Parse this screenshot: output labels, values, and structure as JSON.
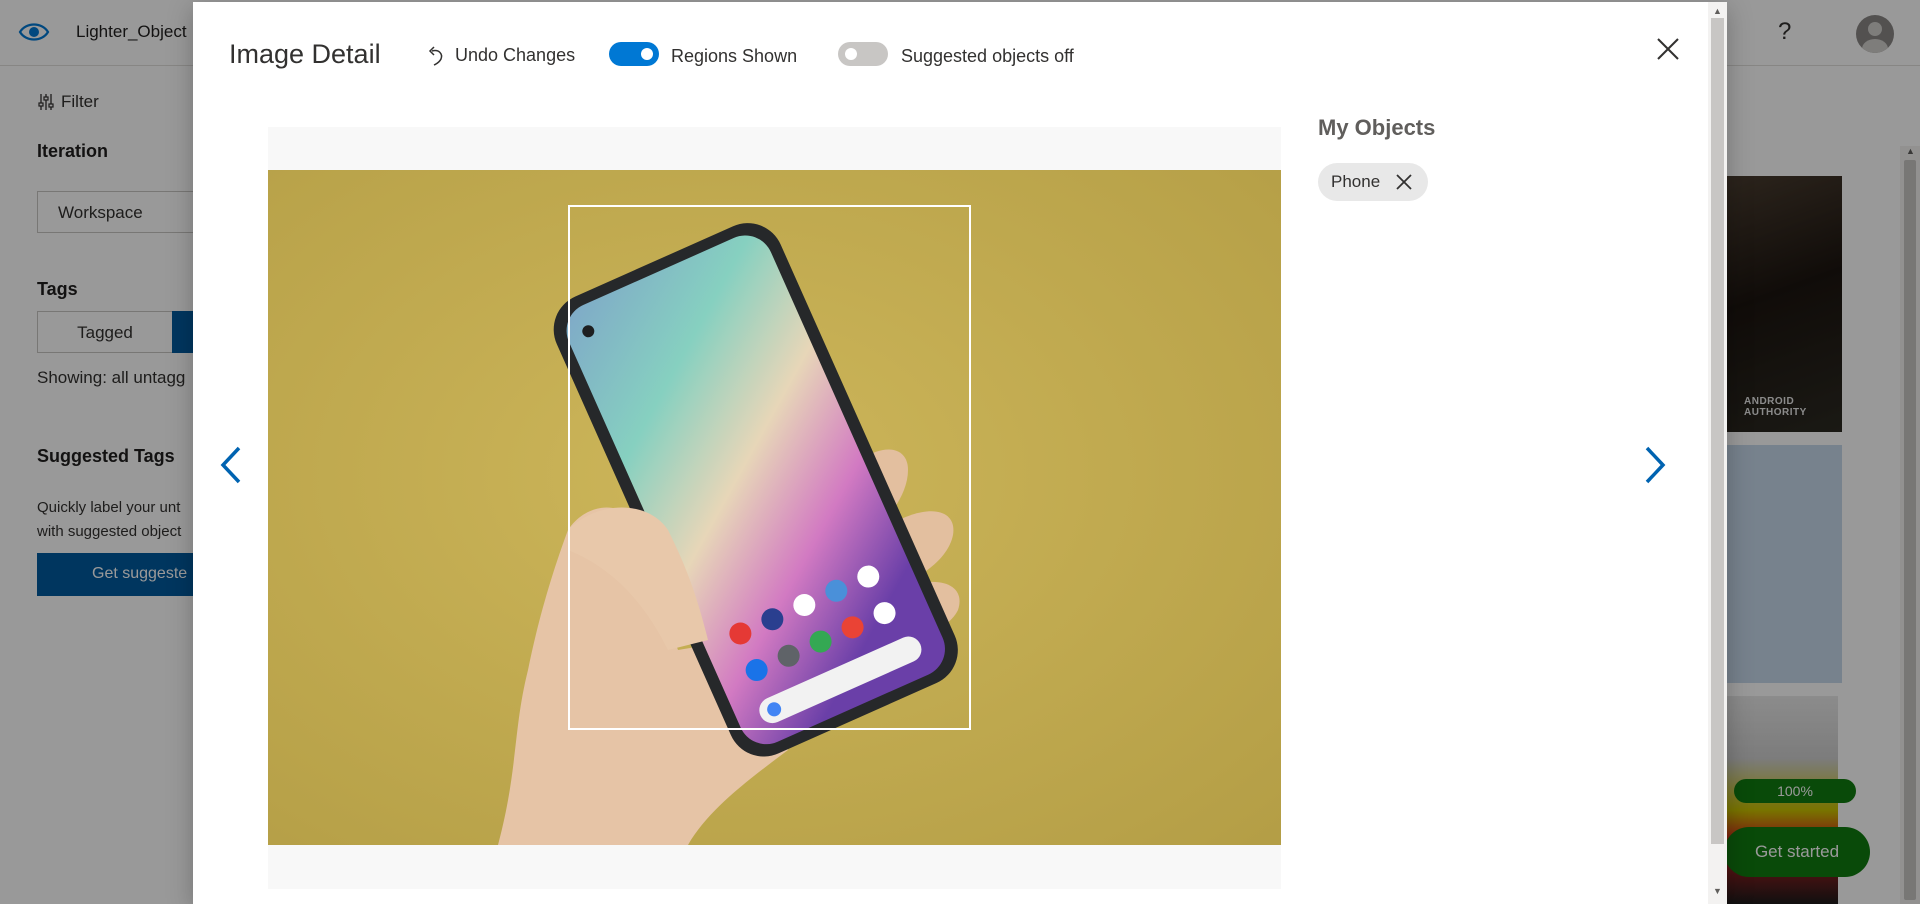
{
  "app": {
    "project_name": "Lighter_Object",
    "help_label": "?",
    "partial_icon_char": "s",
    "filter_label": "Filter",
    "iteration_heading": "Iteration",
    "iteration_value": "Workspace",
    "tags_heading": "Tags",
    "tagged_label": "Tagged",
    "showing_text": "Showing: all untagg",
    "suggested_heading": "Suggested Tags",
    "suggested_desc_line1": "Quickly label your unt",
    "suggested_desc_line2": "with suggested object",
    "suggested_button": "Get suggeste",
    "thumb_watermark": "ANDROID AUTHORITY",
    "progress_label": "100%",
    "get_started_label": "Get started"
  },
  "modal": {
    "title": "Image Detail",
    "undo_label": "Undo Changes",
    "regions_toggle": {
      "label": "Regions Shown",
      "on": true
    },
    "suggested_toggle": {
      "label": "Suggested objects off",
      "on": false
    },
    "objects_heading": "My Objects",
    "objects": [
      {
        "label": "Phone"
      }
    ],
    "colors": {
      "accent": "#0078d4",
      "brand_dark": "#005a9e",
      "success": "#107c10",
      "photo_bg": "#c6b052"
    }
  },
  "icons": {
    "logo": "eye-icon",
    "filter": "filter-sliders-icon",
    "undo": "undo-arrow-icon",
    "close": "close-icon",
    "prev": "chevron-left-icon",
    "next": "chevron-right-icon",
    "remove_tag": "close-icon",
    "avatar": "user-avatar-icon"
  }
}
